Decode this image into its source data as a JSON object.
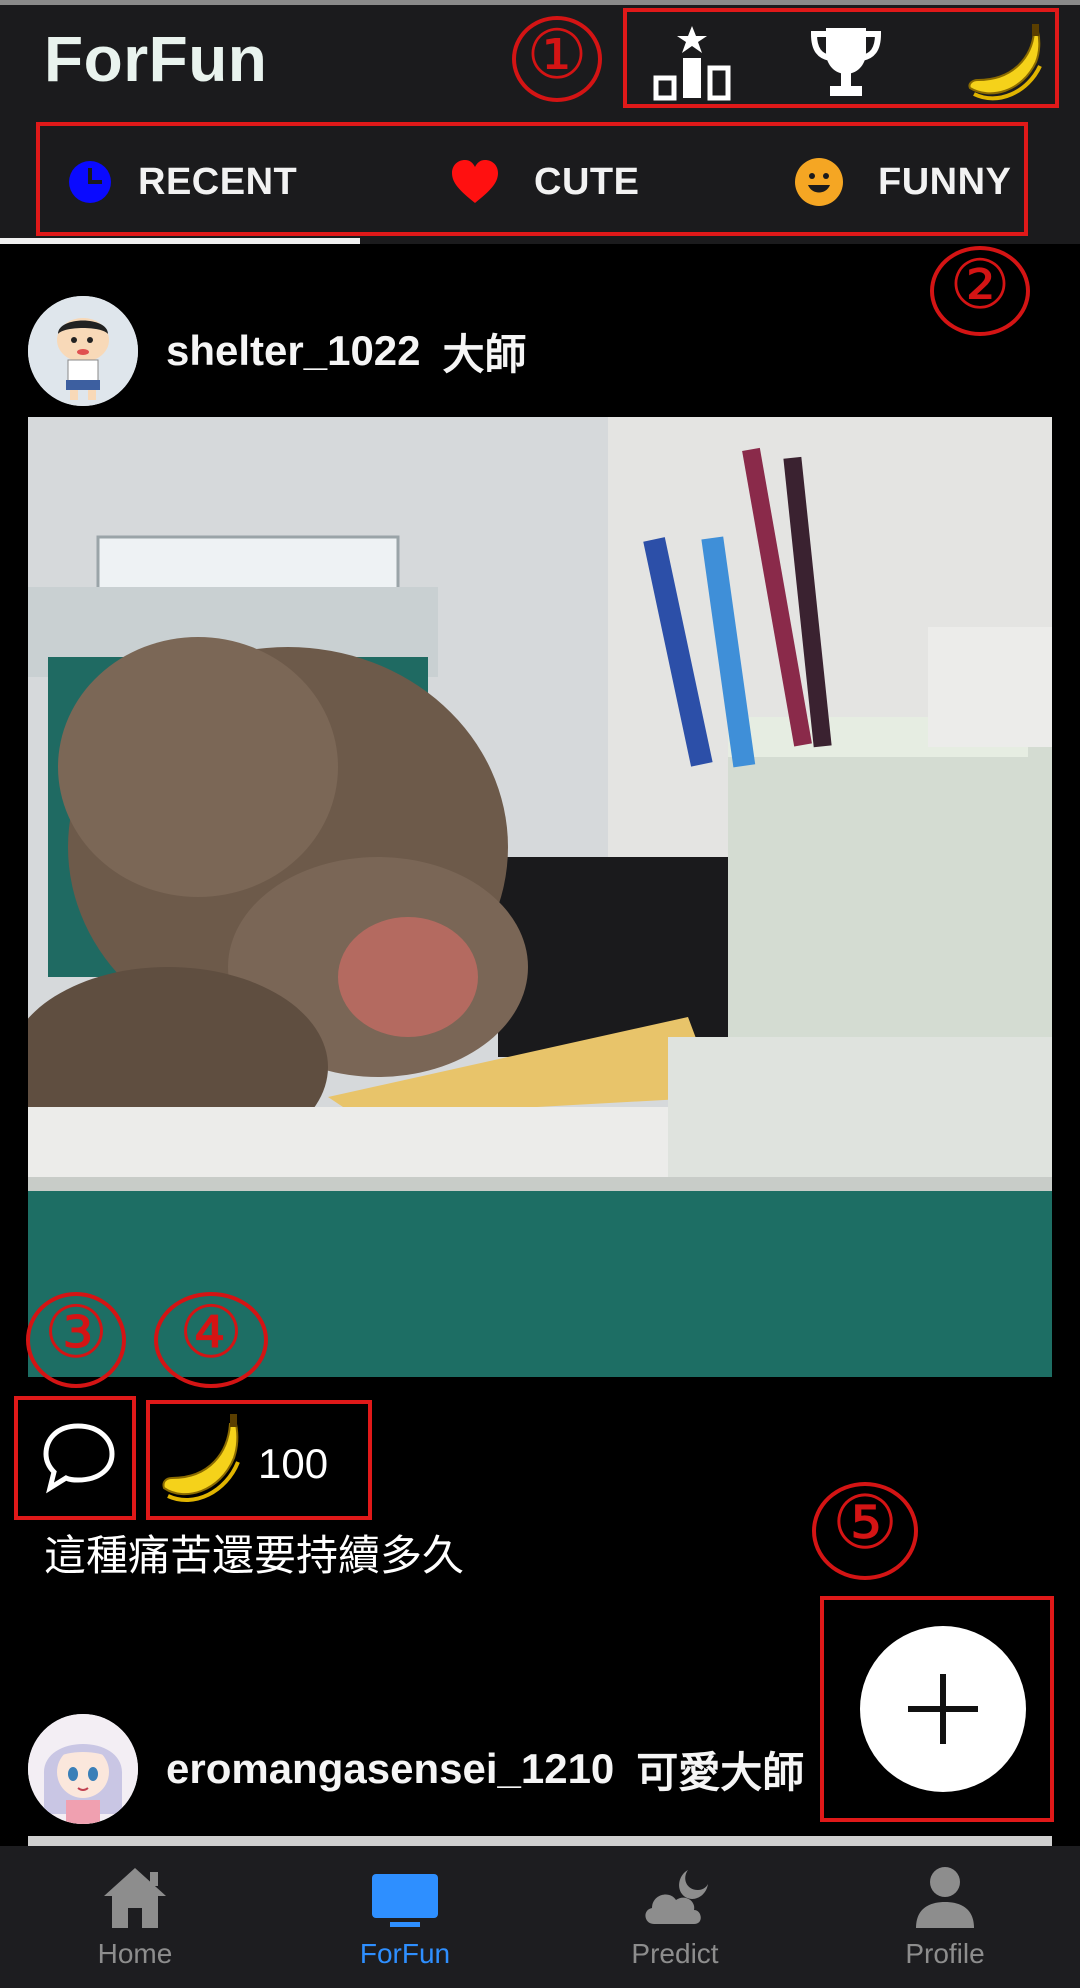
{
  "header": {
    "app_title": "ForFun",
    "icons": [
      "leaderboard-icon",
      "trophy-icon",
      "banana-icon"
    ]
  },
  "tabs": [
    {
      "label": "RECENT",
      "icon": "clock-icon",
      "icon_color": "#0a0aff",
      "active": true
    },
    {
      "label": "CUTE",
      "icon": "heart-icon",
      "icon_color": "#ff1010",
      "active": false
    },
    {
      "label": "FUNNY",
      "icon": "smiley-icon",
      "icon_color": "#f5a623",
      "active": false
    }
  ],
  "posts": [
    {
      "username": "shelter_1022",
      "rank": "大師",
      "banana_count": "100",
      "caption": "這種痛苦還要持續多久"
    },
    {
      "username": "eromangasensei_1210",
      "rank": "可愛大師"
    }
  ],
  "annotations": [
    "①",
    "②",
    "③",
    "④",
    "⑤"
  ],
  "bottom_nav": [
    {
      "label": "Home",
      "icon": "home-icon",
      "active": false
    },
    {
      "label": "ForFun",
      "icon": "tv-icon",
      "active": true
    },
    {
      "label": "Predict",
      "icon": "weather-icon",
      "active": false
    },
    {
      "label": "Profile",
      "icon": "user-icon",
      "active": false
    }
  ],
  "colors": {
    "accent": "#2e8fff",
    "annotation": "#e01919",
    "banana": "#f5d21a",
    "background": "#000000",
    "bar": "#1b1b1d"
  }
}
